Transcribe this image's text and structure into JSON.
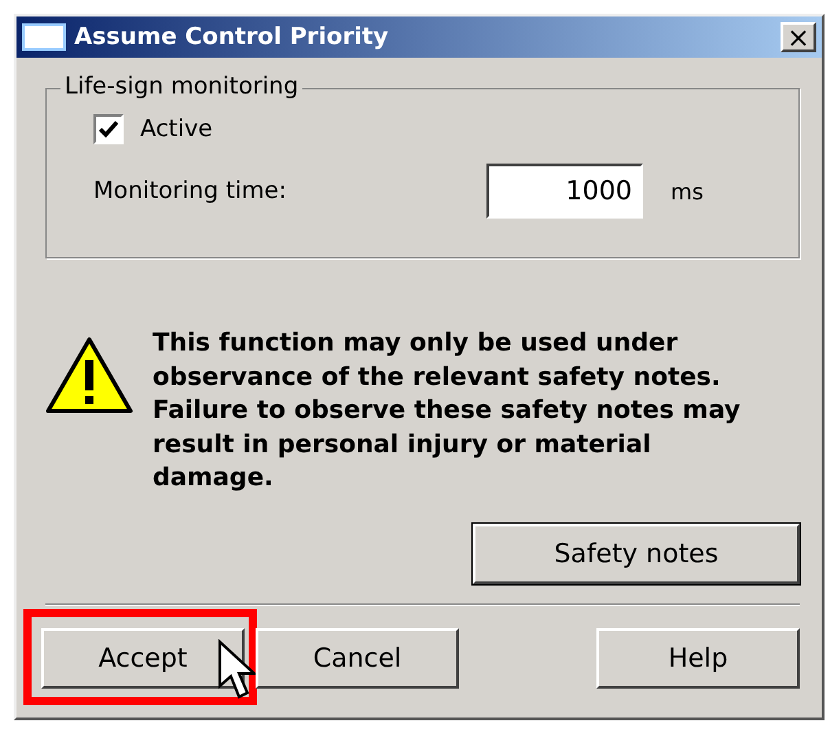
{
  "window": {
    "title": "Assume Control Priority",
    "close": "×"
  },
  "group": {
    "title": "Life-sign monitoring",
    "checkbox": {
      "label": "Active",
      "checked": true
    },
    "field": {
      "label": "Monitoring time:",
      "value": "1000",
      "unit": "ms"
    }
  },
  "warning": {
    "text": "This function may only be used under observance of the relevant safety notes. Failure to observe these safety notes may result in personal injury or material damage."
  },
  "safety_button": "Safety notes",
  "buttons": [
    {
      "label": "Accept",
      "highlighted": true
    },
    {
      "label": "Cancel",
      "highlighted": false
    },
    {
      "label": "Help",
      "highlighted": false
    }
  ]
}
